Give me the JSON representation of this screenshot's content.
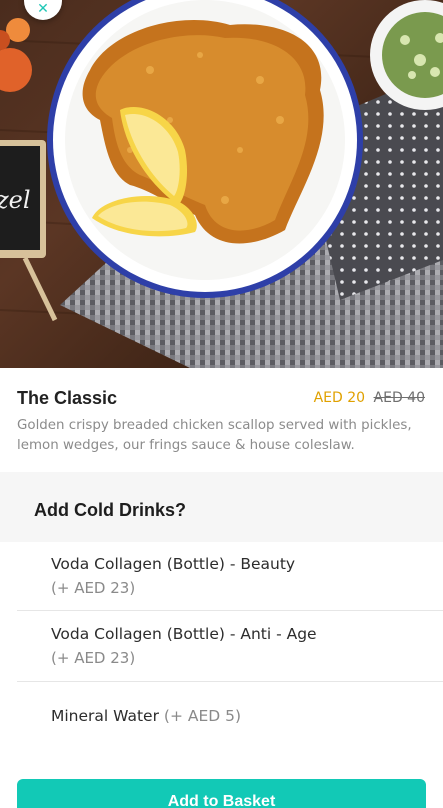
{
  "hero": {
    "chalkboard_text": "zel"
  },
  "product": {
    "name": "The Classic",
    "price_current": "AED 20",
    "price_original": "AED 40",
    "description": "Golden crispy breaded chicken scallop served  with pickles, lemon wedges, our frings sauce & house coleslaw."
  },
  "options_section": {
    "title": "Add Cold Drinks?",
    "items": [
      {
        "name": "Voda Collagen (Bottle) - Beauty",
        "extra": "(+ AED 23)"
      },
      {
        "name": "Voda Collagen (Bottle) - Anti - Age",
        "extra": "(+ AED 23)"
      },
      {
        "name": "Mineral Water",
        "extra": "(+ AED 5)"
      }
    ]
  },
  "footer": {
    "add_button_label": "Add to Basket"
  },
  "colors": {
    "accent": "#12c9b6",
    "price": "#e0a100"
  },
  "icons": {
    "close": "close-icon"
  }
}
